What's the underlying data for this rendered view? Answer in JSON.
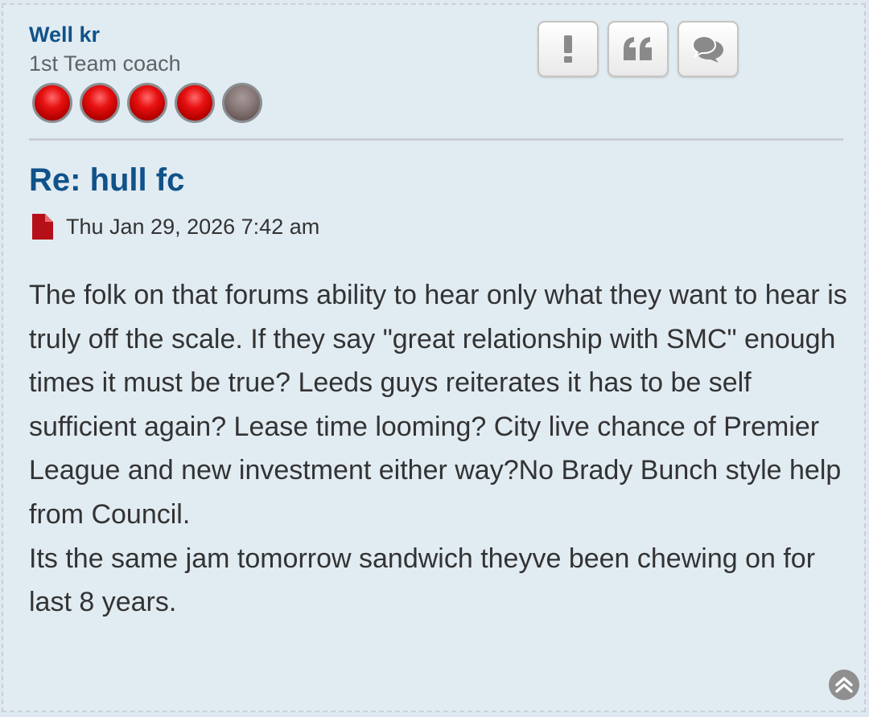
{
  "post": {
    "author": {
      "name": "Well kr",
      "rank_title": "1st Team coach",
      "rank_level": 4,
      "rank_max": 5
    },
    "actions": [
      {
        "name": "report-button",
        "icon": "exclamation-icon"
      },
      {
        "name": "quote-button",
        "icon": "quote-icon"
      },
      {
        "name": "reply-button",
        "icon": "comments-icon"
      }
    ],
    "title": "Re: hull fc",
    "date": "Thu Jan 29, 2026 7:42 am",
    "date_icon": "file-icon",
    "body_lines": [
      "The folk on that forums ability to hear only what they want to hear is truly off the scale. If they say \"great relationship with SMC\" enough times it must be true? Leeds guys reiterates it has to be self sufficient again? Lease time looming? City live chance of Premier League and new investment either way?No Brady Bunch style help from Council.",
      "Its the same jam tomorrow sandwich theyve been chewing on for last 8 years."
    ],
    "back_to_top_icon": "chevron-up-circle-icon"
  },
  "colors": {
    "background": "#e1ebf2",
    "link": "#105289",
    "text": "#333333",
    "rank_on": "#e81212",
    "rank_off": "#7a6a6a"
  }
}
